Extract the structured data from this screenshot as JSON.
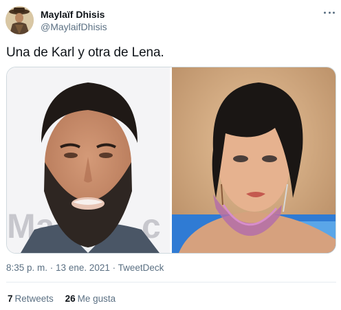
{
  "author": {
    "name": "Maylaïf Dhisis",
    "handle": "@MaylaifDhisis"
  },
  "tweet": {
    "text": "Una de Karl y otra de Lena."
  },
  "media": {
    "left_sign_text": "Ma",
    "right_sign_text": "c"
  },
  "meta": {
    "time": "8:35 p. m.",
    "separator": " · ",
    "date": "13 ene. 2021",
    "source": "TweetDeck"
  },
  "stats": {
    "retweets_count": "7",
    "retweets_label": "Retweets",
    "likes_count": "26",
    "likes_label": "Me gusta"
  },
  "colors": {
    "text_primary": "#0f1419",
    "text_secondary": "#5b7083",
    "border": "#cfd9de"
  },
  "icons": {
    "more": "more-dots-icon"
  }
}
